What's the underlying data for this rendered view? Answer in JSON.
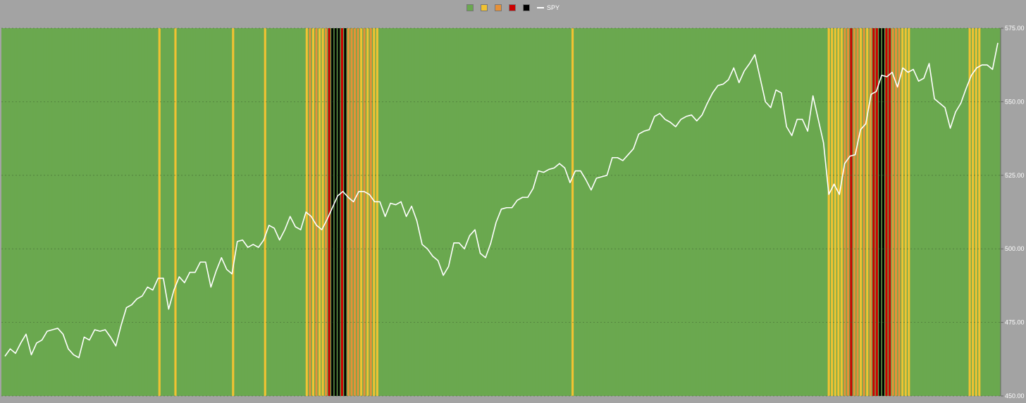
{
  "colors": {
    "background": "#a3a3a3",
    "g": "#6aa84f",
    "y": "#f1c232",
    "o": "#e69138",
    "r": "#cc0000",
    "k": "#000000",
    "line": "#ffffff",
    "gridline": "#4f7f3a"
  },
  "legend": {
    "items": [
      {
        "color": "#6aa84f",
        "label": ""
      },
      {
        "color": "#f1c232",
        "label": ""
      },
      {
        "color": "#e69138",
        "label": ""
      },
      {
        "color": "#cc0000",
        "label": ""
      },
      {
        "color": "#000000",
        "label": ""
      }
    ],
    "line_label": "SPY"
  },
  "chart_data": {
    "type": "bar",
    "title": "",
    "xlabel": "",
    "ylabel": "",
    "legend_placement": "top-center",
    "grid": true,
    "ylim": [
      450,
      575
    ],
    "y_ticks": [
      "450.00",
      "475.00",
      "500.00",
      "525.00",
      "550.00",
      "575.00"
    ],
    "regime_bars": "gggggggggggggggggggggggggggggggggggggggggggggggggyggggygggggggggggggggggygggggggggyggggggggggggyoyoyyorkkkrkooooyoyoyyggggggggggggggggggggggggggggggggggggggggggggggggggggggggggggygggggggggggggggggggggggggggggggggggggggggggggggggggggggggggggggggggggggggggggggyyyyyoorooyoyorrkkrroooyyyggggggggggggggggggyyyygggggg",
    "series": [
      {
        "name": "SPY",
        "values": [
          463.5,
          466,
          464.5,
          468,
          471,
          464,
          468,
          469,
          472,
          472.5,
          473,
          471,
          466,
          464,
          463,
          470,
          469,
          472.5,
          472,
          472.5,
          470,
          467,
          474,
          480,
          481,
          483,
          484,
          487,
          486,
          490,
          490,
          479.5,
          486,
          490.5,
          488.5,
          492,
          492,
          495.5,
          495.5,
          487,
          492.5,
          497,
          493,
          491.5,
          502.5,
          503,
          500.5,
          501.5,
          500.5,
          503,
          508,
          507,
          503,
          506.5,
          511,
          507.5,
          506.5,
          512.5,
          511,
          508,
          506.5,
          510,
          514,
          518,
          519.5,
          517.5,
          516,
          519.5,
          519.5,
          518.5,
          516,
          516,
          511,
          515.5,
          515,
          516,
          511,
          514.5,
          509.5,
          501.5,
          500,
          497.5,
          496,
          491,
          494,
          502,
          502,
          500,
          504.5,
          506.5,
          498.5,
          497,
          502,
          509,
          513.5,
          514,
          514,
          516.5,
          517.5,
          517.5,
          520.5,
          526.5,
          526,
          527,
          527.5,
          529,
          527.5,
          522.5,
          526.5,
          526.5,
          523.5,
          520,
          524,
          524.5,
          525,
          531,
          531,
          530,
          532,
          534,
          539,
          540,
          540.5,
          545,
          546,
          544,
          543,
          541.5,
          544,
          545,
          545.5,
          543.5,
          545.5,
          549.5,
          553,
          555.5,
          556,
          557.5,
          561.5,
          556.5,
          560.5,
          563,
          566,
          558,
          550,
          548,
          554,
          553,
          541.5,
          538.5,
          544,
          544,
          540,
          552,
          544,
          536,
          518.5,
          522,
          518.5,
          529,
          531.5,
          532,
          540.5,
          542.5,
          552.5,
          553.5,
          559,
          558.5,
          560,
          555,
          561.5,
          560,
          561,
          557,
          558,
          563,
          551,
          549.5,
          548,
          541,
          546.5,
          549.5,
          554.5,
          559,
          561.5,
          562.5,
          562.5,
          561,
          570
        ]
      }
    ]
  }
}
